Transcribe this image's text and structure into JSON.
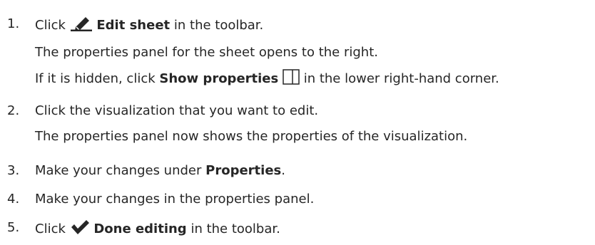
{
  "steps": [
    {
      "number": "1.",
      "pre": "Click",
      "icon": "edit-pencil-icon",
      "bold": "Edit sheet",
      "post": "in the toolbar.",
      "details": [
        "The properties panel for the sheet opens to the right."
      ],
      "detail2": {
        "pre": "If it is hidden, click",
        "bold": "Show properties",
        "icon": "panel-toggle-icon",
        "post": "in the lower right-hand corner."
      }
    },
    {
      "number": "2.",
      "text": "Click the visualization that you want to edit.",
      "detail": "The properties panel now shows the properties of the visualization."
    },
    {
      "number": "3.",
      "pre": "Make your changes under",
      "bold": "Properties",
      "post": "."
    },
    {
      "number": "4.",
      "text": "Make your changes in the properties panel."
    },
    {
      "number": "5.",
      "pre": "Click",
      "icon": "checkmark-icon",
      "bold": "Done editing",
      "post": "in the toolbar."
    }
  ]
}
